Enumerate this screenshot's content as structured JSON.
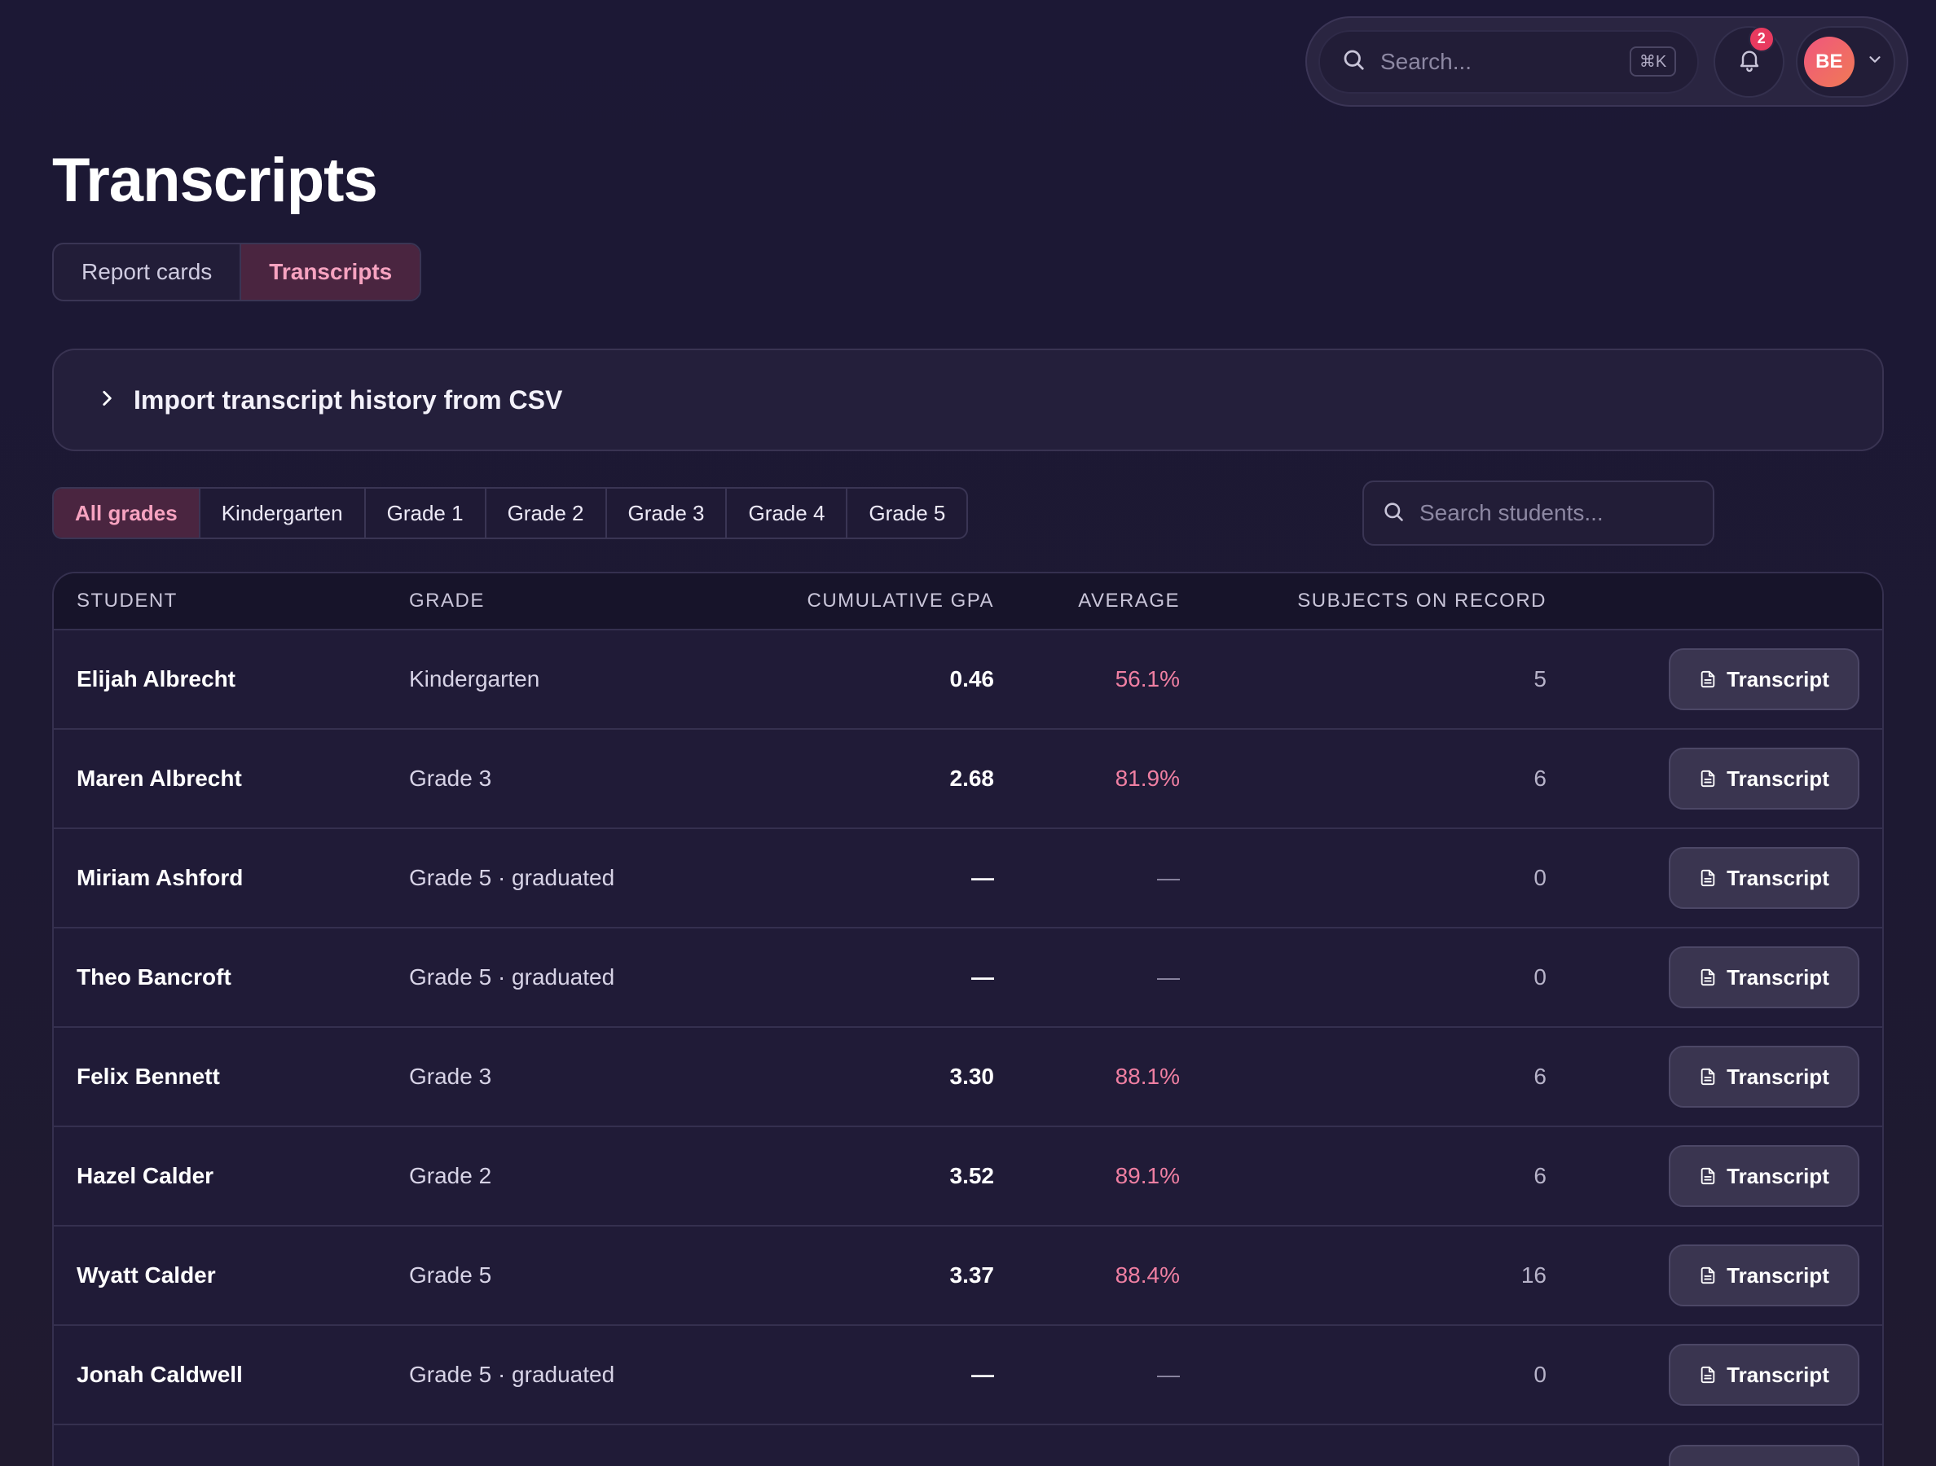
{
  "header": {
    "search_placeholder": "Search...",
    "search_shortcut": "⌘K",
    "notification_count": "2",
    "user_initials": "BE"
  },
  "page": {
    "title": "Transcripts"
  },
  "tabs": [
    {
      "label": "Report cards",
      "active": false
    },
    {
      "label": "Transcripts",
      "active": true
    }
  ],
  "import_panel": {
    "label": "Import transcript history from CSV"
  },
  "grade_filter": [
    {
      "label": "All grades",
      "active": true
    },
    {
      "label": "Kindergarten"
    },
    {
      "label": "Grade 1"
    },
    {
      "label": "Grade 2"
    },
    {
      "label": "Grade 3"
    },
    {
      "label": "Grade 4"
    },
    {
      "label": "Grade 5"
    }
  ],
  "student_search": {
    "placeholder": "Search students..."
  },
  "table": {
    "columns": {
      "student": "STUDENT",
      "grade": "GRADE",
      "gpa": "CUMULATIVE GPA",
      "average": "AVERAGE",
      "subjects": "SUBJECTS ON RECORD"
    },
    "button_label": "Transcript",
    "rows": [
      {
        "student": "Elijah Albrecht",
        "grade": "Kindergarten",
        "gpa": "0.46",
        "average": "56.1%",
        "subjects": "5"
      },
      {
        "student": "Maren Albrecht",
        "grade": "Grade 3",
        "gpa": "2.68",
        "average": "81.9%",
        "subjects": "6"
      },
      {
        "student": "Miriam Ashford",
        "grade": "Grade 5 · graduated",
        "gpa": "—",
        "average": "—",
        "subjects": "0"
      },
      {
        "student": "Theo Bancroft",
        "grade": "Grade 5 · graduated",
        "gpa": "—",
        "average": "—",
        "subjects": "0"
      },
      {
        "student": "Felix Bennett",
        "grade": "Grade 3",
        "gpa": "3.30",
        "average": "88.1%",
        "subjects": "6"
      },
      {
        "student": "Hazel Calder",
        "grade": "Grade 2",
        "gpa": "3.52",
        "average": "89.1%",
        "subjects": "6"
      },
      {
        "student": "Wyatt Calder",
        "grade": "Grade 5",
        "gpa": "3.37",
        "average": "88.4%",
        "subjects": "16"
      },
      {
        "student": "Jonah Caldwell",
        "grade": "Grade 5 · graduated",
        "gpa": "—",
        "average": "—",
        "subjects": "0"
      }
    ]
  },
  "colors": {
    "background": "#1c1835",
    "accent_pink": "#f7a3c0",
    "average_pink": "#ef7fa2",
    "badge_red": "#e83a5f"
  }
}
